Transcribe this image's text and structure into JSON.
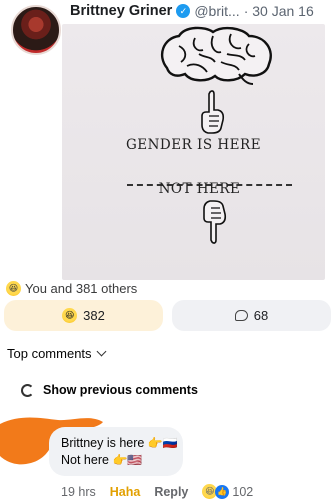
{
  "post": {
    "author": "Brittney Griner",
    "handle": "@brit...",
    "date": "· 30 Jan 16",
    "image": {
      "text_top": "GENDER IS HERE",
      "text_bottom": "NOT HERE"
    }
  },
  "reactions_summary": {
    "text": "You and 381 others"
  },
  "buttons": {
    "reactions_count": "382",
    "comments_count": "68"
  },
  "top_comments": {
    "label": "Top comments"
  },
  "show_previous": {
    "label": "Show previous comments"
  },
  "comment": {
    "line1": "Brittney is here",
    "line2": "Not here",
    "time": "19 hrs",
    "haha": "Haha",
    "reply": "Reply",
    "reaction_count": "102"
  },
  "colors": {
    "verified": "#1d9bf0",
    "haha": "#e2a000",
    "reaction_button_bg": "#fdf1d9",
    "redaction": "#f27a1a"
  }
}
